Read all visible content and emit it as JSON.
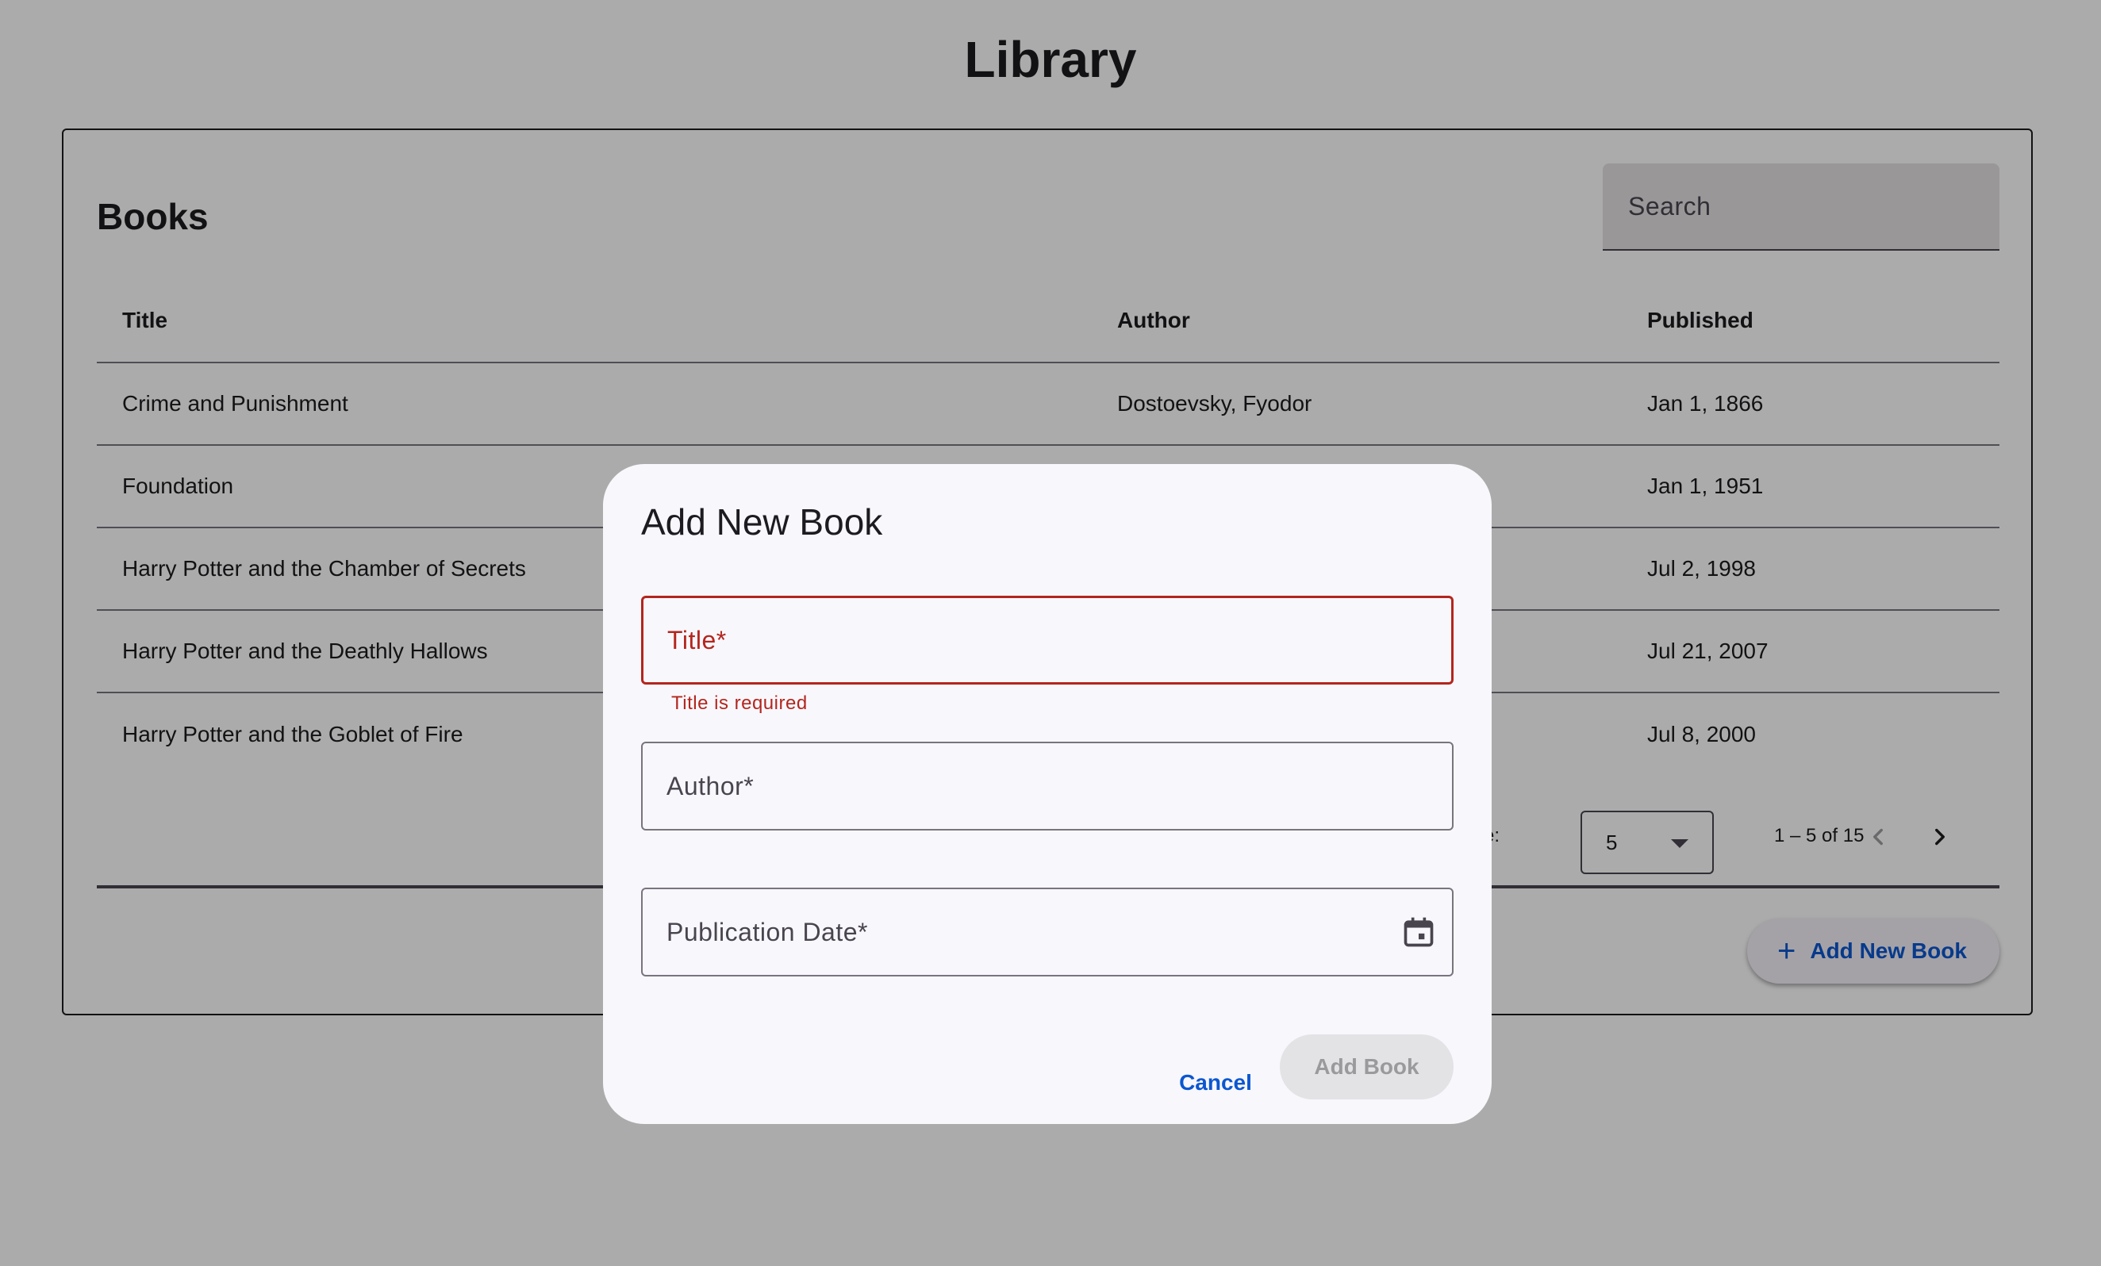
{
  "page": {
    "title": "Library"
  },
  "books_card": {
    "title": "Books",
    "search_placeholder": "Search",
    "columns": [
      "Title",
      "Author",
      "Published"
    ],
    "rows": [
      {
        "title": "Crime and Punishment",
        "author": "Dostoevsky, Fyodor",
        "published": "Jan 1, 1866"
      },
      {
        "title": "Foundation",
        "author": "",
        "published": "Jan 1, 1951"
      },
      {
        "title": "Harry Potter and the Chamber of Secrets",
        "author": "",
        "published": "Jul 2, 1998"
      },
      {
        "title": "Harry Potter and the Deathly Hallows",
        "author": "",
        "published": "Jul 21, 2007"
      },
      {
        "title": "Harry Potter and the Goblet of Fire",
        "author": "",
        "published": "Jul 8, 2000"
      }
    ],
    "paginator": {
      "label_fragment": "e:",
      "page_size": "5",
      "range": "1 – 5 of 15"
    },
    "add_button_label": "Add New Book"
  },
  "dialog": {
    "title": "Add New Book",
    "title_field": {
      "label": "Title*",
      "error": "Title is required"
    },
    "author_field": {
      "label": "Author*"
    },
    "date_field": {
      "label": "Publication Date*"
    },
    "cancel_label": "Cancel",
    "submit_label": "Add Book"
  },
  "colors": {
    "primary": "#0b57d0",
    "error": "#b3261e",
    "scrim": "rgba(0,0,0,0.33)"
  },
  "icons": [
    "chevron-left-icon",
    "chevron-right-icon",
    "dropdown-caret-icon",
    "plus-icon",
    "calendar-icon"
  ]
}
